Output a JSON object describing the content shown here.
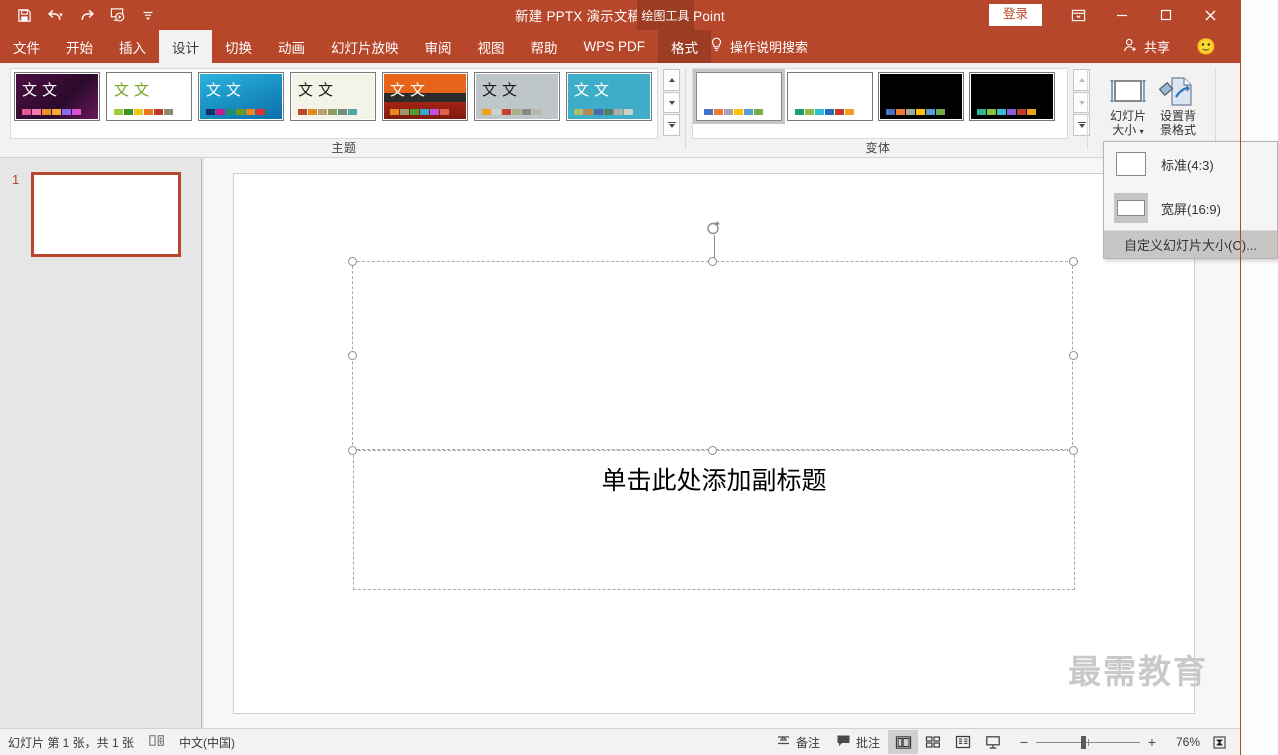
{
  "window": {
    "title": "新建 PPTX 演示文稿  -  PowerPoint",
    "context_tab": "绘图工具",
    "signin_label": "登录",
    "accent_color": "#b7472a",
    "ribbon_bg": "#f3f2f1"
  },
  "quick_access": [
    {
      "name": "save-button",
      "icon": "save-icon"
    },
    {
      "name": "undo-button",
      "icon": "undo-icon"
    },
    {
      "name": "redo-button",
      "icon": "redo-icon"
    },
    {
      "name": "start-slideshow-button",
      "icon": "slideshow-icon"
    },
    {
      "name": "customize-qat-button",
      "icon": "chevron-down-icon"
    }
  ],
  "window_buttons": [
    {
      "name": "ribbon-display-options-button",
      "icon": "ribbon-options-icon"
    },
    {
      "name": "minimize-button",
      "icon": "minimize-icon"
    },
    {
      "name": "maximize-button",
      "icon": "maximize-icon"
    },
    {
      "name": "close-button",
      "icon": "close-icon"
    }
  ],
  "tabs": [
    {
      "label": "文件",
      "active": false
    },
    {
      "label": "开始",
      "active": false
    },
    {
      "label": "插入",
      "active": false
    },
    {
      "label": "设计",
      "active": true
    },
    {
      "label": "切换",
      "active": false
    },
    {
      "label": "动画",
      "active": false
    },
    {
      "label": "幻灯片放映",
      "active": false
    },
    {
      "label": "审阅",
      "active": false
    },
    {
      "label": "视图",
      "active": false
    },
    {
      "label": "帮助",
      "active": false
    },
    {
      "label": "WPS PDF",
      "active": false
    },
    {
      "label": "格式",
      "active": false,
      "contextual": true
    }
  ],
  "tell_me": {
    "label": "操作说明搜索",
    "icon": "lightbulb-icon"
  },
  "share": {
    "label": "共享",
    "icon": "person-add-icon"
  },
  "emoji": {
    "glyph": "🙂"
  },
  "ribbon": {
    "themes_group": {
      "label": "主题",
      "preview_text": "文文",
      "thumbs": [
        {
          "name": "theme-facet-purple",
          "bg": "linear-gradient(135deg,#4b0f43,#2b0a2b 60%,#6a1a5c)",
          "text_color": "#ffffff",
          "swatches": [
            "#e9568f",
            "#f07da8",
            "#f48b2a",
            "#f6a83c",
            "#8a6cf0",
            "#d94fd9"
          ]
        },
        {
          "name": "theme-green-leaf",
          "bg": "#ffffff",
          "text_color": "#76a22a",
          "swatches": [
            "#9ccb3b",
            "#3f8f29",
            "#f0c419",
            "#e8761f",
            "#c9362a",
            "#8d8a6a"
          ]
        },
        {
          "name": "theme-blue-gradient",
          "bg": "linear-gradient(160deg,#2bb3e0,#0a6fa8)",
          "text_color": "#ffffff",
          "swatches": [
            "#14306b",
            "#c01f8a",
            "#1d8f6e",
            "#6f9a1e",
            "#e8891f",
            "#d6372a"
          ]
        },
        {
          "name": "theme-cream-wood",
          "bg": "#f4f3e7",
          "text_color": "#1a1a1a",
          "swatches": [
            "#c0452a",
            "#e08a20",
            "#b8a06a",
            "#8d9b6a",
            "#6f8f7a",
            "#4fa6a6"
          ]
        },
        {
          "name": "theme-orange-banded",
          "bg": "linear-gradient(180deg,#e8641a 0%,#e8641a 42%,#2b2b2b 42%,#2b2b2b 62%,#a32414 62%,#7d1c0e 100%)",
          "text_color": "#ffffff",
          "swatches": [
            "#e8891f",
            "#9b9b6a",
            "#4f9b3a",
            "#3aa5c9",
            "#c44fd9",
            "#e0604a"
          ]
        },
        {
          "name": "theme-gray-plain",
          "bg": "#bfc6c9",
          "text_color": "#1a1a1a",
          "swatches": [
            "#f0a01a",
            "#cfcfcf",
            "#c0452a",
            "#a8b08a",
            "#8a8a7a",
            "#b5b5ad"
          ]
        },
        {
          "name": "theme-teal",
          "bg": "#3eaec8",
          "text_color": "#ffffff",
          "swatches": [
            "#b5bd6a",
            "#b58a4a",
            "#4a6aa5",
            "#5a7a6a",
            "#b0b0a8",
            "#cfcfc7"
          ]
        }
      ],
      "scroll_buttons": [
        {
          "name": "themes-scroll-up-button",
          "icon": "chevron-up-icon"
        },
        {
          "name": "themes-scroll-down-button",
          "icon": "chevron-down-icon"
        },
        {
          "name": "themes-more-button",
          "icon": "more-gallery-icon"
        }
      ]
    },
    "variants_group": {
      "label": "变体",
      "thumbs": [
        {
          "name": "variant-1",
          "bg": "#ffffff",
          "selected": true,
          "swatches": [
            "#4472c4",
            "#ed7d31",
            "#a5a5a5",
            "#ffc000",
            "#5b9bd5",
            "#70ad47"
          ]
        },
        {
          "name": "variant-2",
          "bg": "#ffffff",
          "selected": false,
          "swatches": [
            "#1b9e77",
            "#8ebf3f",
            "#2fbfd4",
            "#1f6fb5",
            "#c0392b",
            "#f0a01a"
          ]
        },
        {
          "name": "variant-3",
          "bg": "#000000",
          "selected": false,
          "swatches": [
            "#4472c4",
            "#ed7d31",
            "#a5a5a5",
            "#ffc000",
            "#5b9bd5",
            "#70ad47"
          ]
        },
        {
          "name": "variant-4",
          "bg": "#000000",
          "selected": false,
          "swatches": [
            "#2fb39b",
            "#8ebf3f",
            "#2fbfd4",
            "#8a5fd0",
            "#c0392b",
            "#f0a01a"
          ]
        }
      ],
      "scroll_buttons": [
        {
          "name": "variants-scroll-up-button",
          "icon": "chevron-up-icon"
        },
        {
          "name": "variants-scroll-down-button",
          "icon": "chevron-down-icon"
        },
        {
          "name": "variants-more-button",
          "icon": "more-gallery-icon"
        }
      ]
    },
    "size_group": {
      "slide_size": {
        "label_line1": "幻灯片",
        "label_line2": "大小",
        "icon": "slide-size-icon",
        "has_dropdown": true,
        "expanded": true
      },
      "format_background": {
        "label_line1": "设置背",
        "label_line2": "景格式",
        "icon": "format-background-icon"
      }
    }
  },
  "slide_size_menu": {
    "items": [
      {
        "label": "标准(4:3)",
        "name": "menu-item-standard-4-3",
        "icon": "slide-4-3-icon"
      },
      {
        "label": "宽屏(16:9)",
        "name": "menu-item-widescreen-16-9",
        "icon": "slide-16-9-icon",
        "highlighted": true
      }
    ],
    "custom": {
      "label": "自定义幻灯片大小(C)...",
      "name": "menu-item-custom-slide-size"
    }
  },
  "thumbnail_pane": {
    "slides": [
      {
        "number": "1",
        "selected": true
      }
    ]
  },
  "slide_editor": {
    "title_placeholder": {
      "text": "",
      "name": "title-placeholder",
      "selected": true
    },
    "subtitle_placeholder": {
      "text": "单击此处添加副标题",
      "name": "subtitle-placeholder",
      "selected": true
    }
  },
  "watermark": {
    "text": "最需教育"
  },
  "status_bar": {
    "slide_info": "幻灯片 第 1 张，共 1 张",
    "accessibility_icon": "accessibility-check-icon",
    "language": "中文(中国)",
    "notes": {
      "label": "备注",
      "icon": "notes-icon"
    },
    "comments": {
      "label": "批注",
      "icon": "comment-icon"
    },
    "views": [
      {
        "name": "view-normal-button",
        "icon": "normal-view-icon",
        "active": true
      },
      {
        "name": "view-slide-sorter-button",
        "icon": "slide-sorter-icon",
        "active": false
      },
      {
        "name": "view-reading-button",
        "icon": "reading-view-icon",
        "active": false
      },
      {
        "name": "view-slideshow-button",
        "icon": "slideshow-view-icon",
        "active": false
      }
    ],
    "zoom": {
      "out_label": "−",
      "in_label": "+",
      "value": "76%",
      "fit_icon": "fit-to-window-icon"
    }
  }
}
